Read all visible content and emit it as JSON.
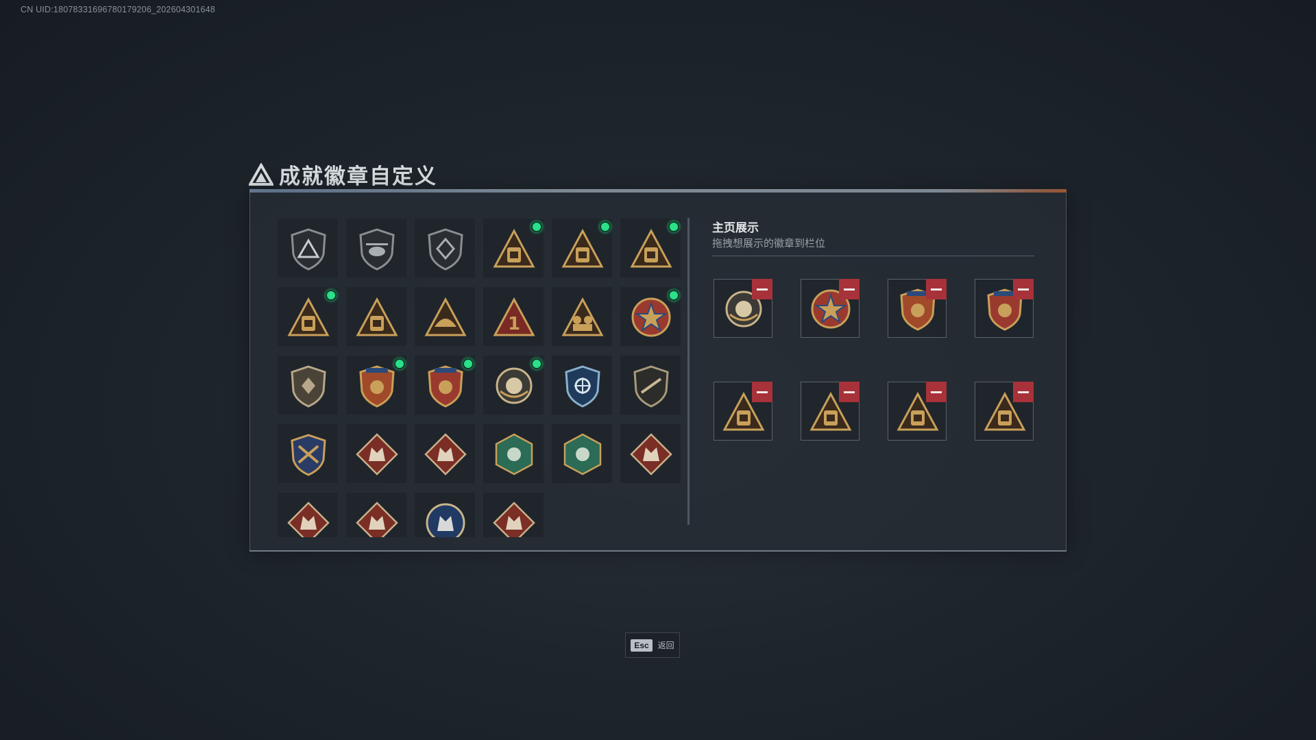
{
  "uid_text": "CN UID:1807833169678017920​6_202604301648",
  "title": "成就徽章自定义",
  "colors": {
    "gold": "#c9a05a",
    "bronze": "#8c6a3a",
    "red_badge": "#9a3a2f",
    "green_badge": "#2c6b55",
    "blue_badge": "#2b4a7a",
    "new_dot": "#2be08a",
    "remove": "#a8323a"
  },
  "collection": [
    {
      "icon": "shield-triangle-logo-icon",
      "new": false
    },
    {
      "icon": "helicopter-badge-icon",
      "new": false
    },
    {
      "icon": "diamond-emblem-badge-icon",
      "new": false
    },
    {
      "icon": "s4-backpack-badge-icon",
      "new": true
    },
    {
      "icon": "s5-backpack-badge-icon",
      "new": true
    },
    {
      "icon": "s6-backpack-badge-icon",
      "new": true
    },
    {
      "icon": "s7-backpack-badge-icon",
      "new": true
    },
    {
      "icon": "s8-backpack-badge-icon",
      "new": false
    },
    {
      "icon": "helmet-triangle-badge-icon",
      "new": false
    },
    {
      "icon": "number-one-triangle-badge-icon",
      "new": false
    },
    {
      "icon": "soldiers-triangle-badge-icon",
      "new": false
    },
    {
      "icon": "star-medal-badge-icon",
      "new": true
    },
    {
      "icon": "shield-emblem-badge-icon",
      "new": false
    },
    {
      "icon": "stars-shield-gold-badge-icon",
      "new": true
    },
    {
      "icon": "stars-shield-red-badge-icon",
      "new": true
    },
    {
      "icon": "orb-ring-badge-icon",
      "new": true
    },
    {
      "icon": "crosshair-blue-shield-badge-icon",
      "new": false
    },
    {
      "icon": "rifle-shield-badge-icon",
      "new": false
    },
    {
      "icon": "crossed-weapons-gold-badge-icon",
      "new": false
    },
    {
      "icon": "wolf-red-diamond-badge-icon",
      "new": false
    },
    {
      "icon": "wolf-red-diamond-2-badge-icon",
      "new": false
    },
    {
      "icon": "hornet-green-hex-badge-icon",
      "new": false
    },
    {
      "icon": "soldier-green-hex-badge-icon",
      "new": false
    },
    {
      "icon": "dragon-red-diamond-badge-icon",
      "new": false
    },
    {
      "icon": "dragon-red-diamond-2-badge-icon",
      "new": false
    },
    {
      "icon": "runner-red-diamond-badge-icon",
      "new": false
    },
    {
      "icon": "wolf-blue-circle-badge-icon",
      "new": false
    },
    {
      "icon": "vest-red-diamond-badge-icon",
      "new": false
    }
  ],
  "showcase": {
    "title": "主页展示",
    "subtitle": "拖拽想展示的徽章到栏位",
    "slots": [
      {
        "icon": "orb-ring-badge-icon"
      },
      {
        "icon": "star-medal-badge-icon"
      },
      {
        "icon": "stars-shield-gold-badge-icon"
      },
      {
        "icon": "stars-shield-red-badge-icon"
      },
      {
        "icon": "s4-backpack-badge-icon"
      },
      {
        "icon": "s5-backpack-badge-icon"
      },
      {
        "icon": "s6-backpack-badge-icon"
      },
      {
        "icon": "s7-backpack-badge-icon"
      }
    ]
  },
  "footer": {
    "key": "Esc",
    "label": "返回"
  }
}
